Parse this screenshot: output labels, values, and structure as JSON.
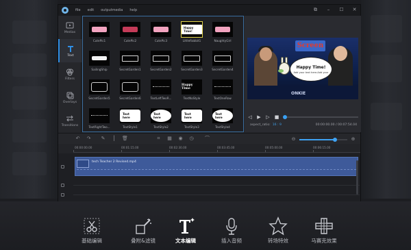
{
  "app": {
    "menu": [
      "file",
      "edit",
      "outputmedia",
      "help"
    ],
    "window_controls": [
      "restore-down",
      "minimize",
      "maximize",
      "close"
    ]
  },
  "sidebar": {
    "tabs": [
      {
        "label": "Medias",
        "icon": "media-icon"
      },
      {
        "label": "Text",
        "icon": "text-icon",
        "active": true
      },
      {
        "label": "Filters",
        "icon": "filters-icon"
      },
      {
        "label": "Overlays",
        "icon": "overlays-icon"
      },
      {
        "label": "Transitions",
        "icon": "transitions-icon"
      }
    ]
  },
  "text_grid": {
    "items": [
      {
        "label": "CutePic1",
        "style": "ribbon-pink",
        "text": ""
      },
      {
        "label": "CutePic2",
        "style": "ribbon-red",
        "text": ""
      },
      {
        "label": "CutePic3",
        "style": "ribbon-pink",
        "text": ""
      },
      {
        "label": "LittleRabbit1",
        "style": "pill",
        "text": "Happy Time!",
        "selected": true
      },
      {
        "label": "NaughtyGirl",
        "style": "ribbon-pink",
        "text": ""
      },
      {
        "label": "SailingShip",
        "style": "ribbon-white",
        "text": ""
      },
      {
        "label": "SecretGarden1",
        "style": "banner",
        "text": ""
      },
      {
        "label": "SecretGarden2",
        "style": "banner",
        "text": ""
      },
      {
        "label": "SecretGarden3",
        "style": "banner",
        "text": ""
      },
      {
        "label": "SecretGarden4",
        "style": "banner",
        "text": ""
      },
      {
        "label": "SecretGarden5",
        "style": "frame",
        "text": ""
      },
      {
        "label": "SecretGarden6",
        "style": "frame",
        "text": ""
      },
      {
        "label": "TextLeftTwoR...",
        "style": "dots",
        "text": ""
      },
      {
        "label": "TextNoStyle",
        "style": "plain",
        "text": "Happy Time"
      },
      {
        "label": "TextOneRow",
        "style": "dots",
        "text": ""
      },
      {
        "label": "TextRightTwo...",
        "style": "dots",
        "text": ""
      },
      {
        "label": "TextStyle1",
        "style": "bubble-sq",
        "text": "Text here"
      },
      {
        "label": "TextStyle2",
        "style": "bubble",
        "text": "Text here"
      },
      {
        "label": "TextStyle3",
        "style": "bubble-sq",
        "text": "Text here"
      },
      {
        "label": "TextStyle4",
        "style": "bubble",
        "text": "Text here"
      }
    ]
  },
  "preview": {
    "sign_text": "Screen",
    "overlay_title": "Happy Time!",
    "overlay_sub": "Add your text here.Add your",
    "desk_text": "ONKIE",
    "aspect_label": "aspect_ratio:",
    "aspect_value": "16 : 9",
    "timecode": "00:00:00.00 / 00:07:54.04",
    "progress": 0
  },
  "timeline": {
    "ruler_marks": [
      "00:00:00.00",
      "00:01:15.00",
      "00:02:30.00",
      "00:03:45.00",
      "00:05:00.00",
      "00:06:15.00"
    ],
    "clip_name": "tech Teacher 2 Revised.mp4",
    "zoom_level": 0.74
  },
  "features": [
    {
      "label": "基础编辑",
      "icon": "scissors-icon"
    },
    {
      "label": "叠附&滤镜",
      "icon": "magic-wand-icon"
    },
    {
      "label": "文本编辑",
      "icon": "text-edit-icon",
      "active": true
    },
    {
      "label": "插入音频",
      "icon": "microphone-icon"
    },
    {
      "label": "转场特效",
      "icon": "star-icon"
    },
    {
      "label": "马赛克效果",
      "icon": "mosaic-icon"
    }
  ],
  "colors": {
    "accent": "#2f8fe6",
    "selection": "#e3d54a",
    "clip": "#3e5a9a"
  }
}
